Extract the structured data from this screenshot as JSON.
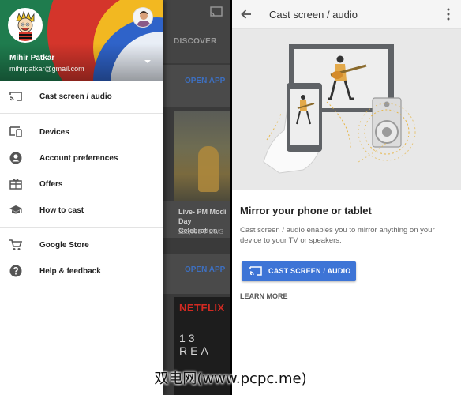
{
  "background_app": {
    "tab_label": "DISCOVER",
    "open_app_label": "OPEN APP",
    "video_title": "Live- PM Modi Day Celebration",
    "video_views": "222,959 VIEWS",
    "movie_brand": "NETFLIX",
    "movie_title": "13 REA"
  },
  "drawer": {
    "user_name": "Mihir Patkar",
    "user_email": "mihirpatkar@gmail.com",
    "items": [
      {
        "label": "Cast screen / audio",
        "icon": "cast-icon"
      },
      {
        "label": "Devices",
        "icon": "devices-icon"
      },
      {
        "label": "Account preferences",
        "icon": "account-circle-icon"
      },
      {
        "label": "Offers",
        "icon": "gift-card-icon"
      },
      {
        "label": "How to cast",
        "icon": "school-icon"
      },
      {
        "label": "Google Store",
        "icon": "cart-icon"
      },
      {
        "label": "Help & feedback",
        "icon": "help-icon"
      }
    ]
  },
  "right": {
    "toolbar_title": "Cast screen / audio",
    "heading": "Mirror your phone or tablet",
    "description": "Cast screen / audio enables you to mirror anything on your device to your TV or speakers.",
    "cast_button_label": "CAST SCREEN / AUDIO",
    "learn_more_label": "LEARN MORE"
  },
  "watermark": "双电网(www.pcpc.me)",
  "colors": {
    "accent_blue": "#3d74d6",
    "drawer_header_green": "#1f7c4e",
    "hero_background": "#e8e8e8"
  }
}
